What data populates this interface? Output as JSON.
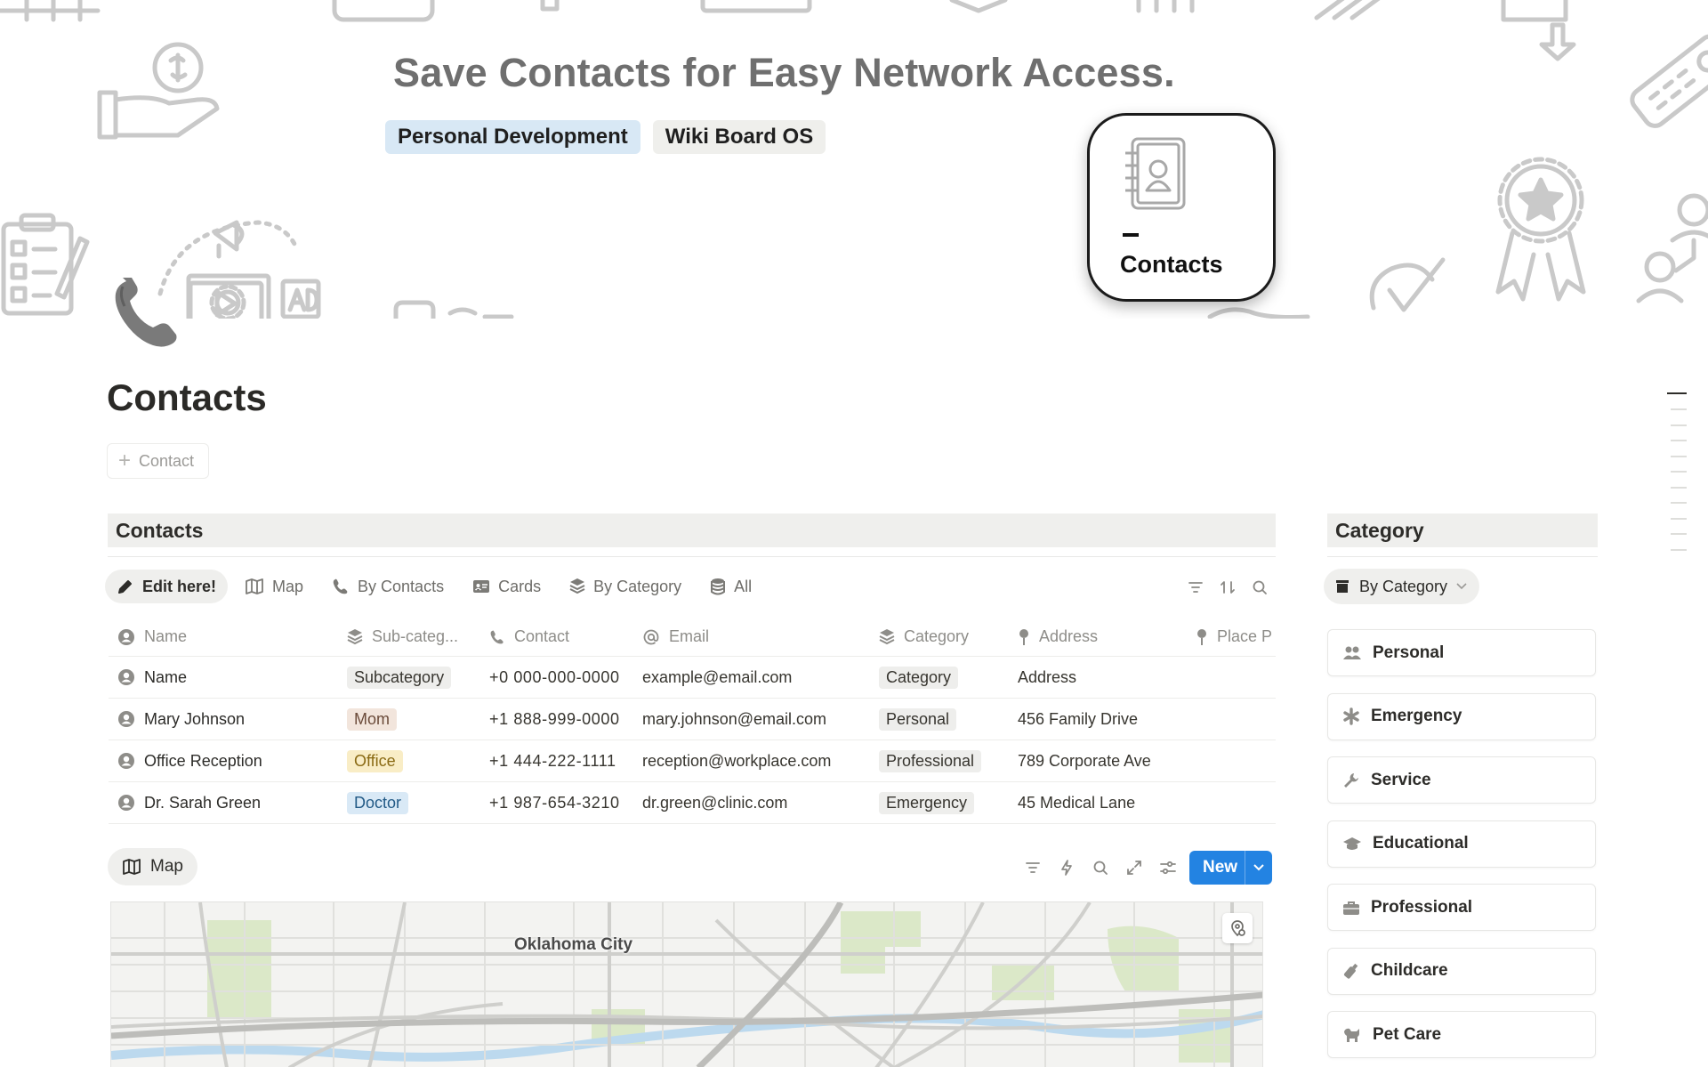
{
  "cover": {
    "title": "Save Contacts for Easy Network Access.",
    "tags": [
      "Personal Development",
      "Wiki Board OS"
    ],
    "tile_label": "Contacts"
  },
  "page": {
    "title": "Contacts",
    "new_button": "Contact"
  },
  "contacts_section": {
    "heading": "Contacts",
    "views": [
      {
        "label": "Edit here!",
        "icon": "pencil-icon"
      },
      {
        "label": "Map",
        "icon": "map-icon"
      },
      {
        "label": "By Contacts",
        "icon": "phone-icon"
      },
      {
        "label": "Cards",
        "icon": "card-icon"
      },
      {
        "label": "By Category",
        "icon": "stack-icon"
      },
      {
        "label": "All",
        "icon": "database-icon"
      }
    ],
    "columns": [
      "Name",
      "Sub-categ...",
      "Contact",
      "Email",
      "Category",
      "Address",
      "Place P"
    ],
    "rows": [
      {
        "name": "Name",
        "sub": "Subcategory",
        "sub_color": "grey",
        "contact": "+0 000-000-0000",
        "email": "example@email.com",
        "category": "Category",
        "address": "Address"
      },
      {
        "name": "Mary Johnson",
        "sub": "Mom",
        "sub_color": "brown",
        "contact": "+1 888-999-0000",
        "email": "mary.johnson@email.com",
        "category": "Personal",
        "address": "456 Family Drive"
      },
      {
        "name": "Office Reception",
        "sub": "Office",
        "sub_color": "yellow",
        "contact": "+1 444-222-1111",
        "email": "reception@workplace.com",
        "category": "Professional",
        "address": "789 Corporate Ave"
      },
      {
        "name": "Dr. Sarah Green",
        "sub": "Doctor",
        "sub_color": "blue",
        "contact": "+1 987-654-3210",
        "email": "dr.green@clinic.com",
        "category": "Emergency",
        "address": "45 Medical Lane"
      }
    ]
  },
  "map_section": {
    "tab_label": "Map",
    "new_button": "New",
    "city_label": "Oklahoma City"
  },
  "category_section": {
    "heading": "Category",
    "view_label": "By Category",
    "items": [
      {
        "label": "Personal",
        "icon": "people-icon"
      },
      {
        "label": "Emergency",
        "icon": "asterisk-icon"
      },
      {
        "label": "Service",
        "icon": "wrench-icon"
      },
      {
        "label": "Educational",
        "icon": "graduation-cap-icon"
      },
      {
        "label": "Professional",
        "icon": "briefcase-icon"
      },
      {
        "label": "Childcare",
        "icon": "bottle-icon"
      },
      {
        "label": "Pet Care",
        "icon": "dog-icon"
      }
    ]
  },
  "colors": {
    "accent": "#2383e2",
    "section_bg": "#efefed"
  }
}
